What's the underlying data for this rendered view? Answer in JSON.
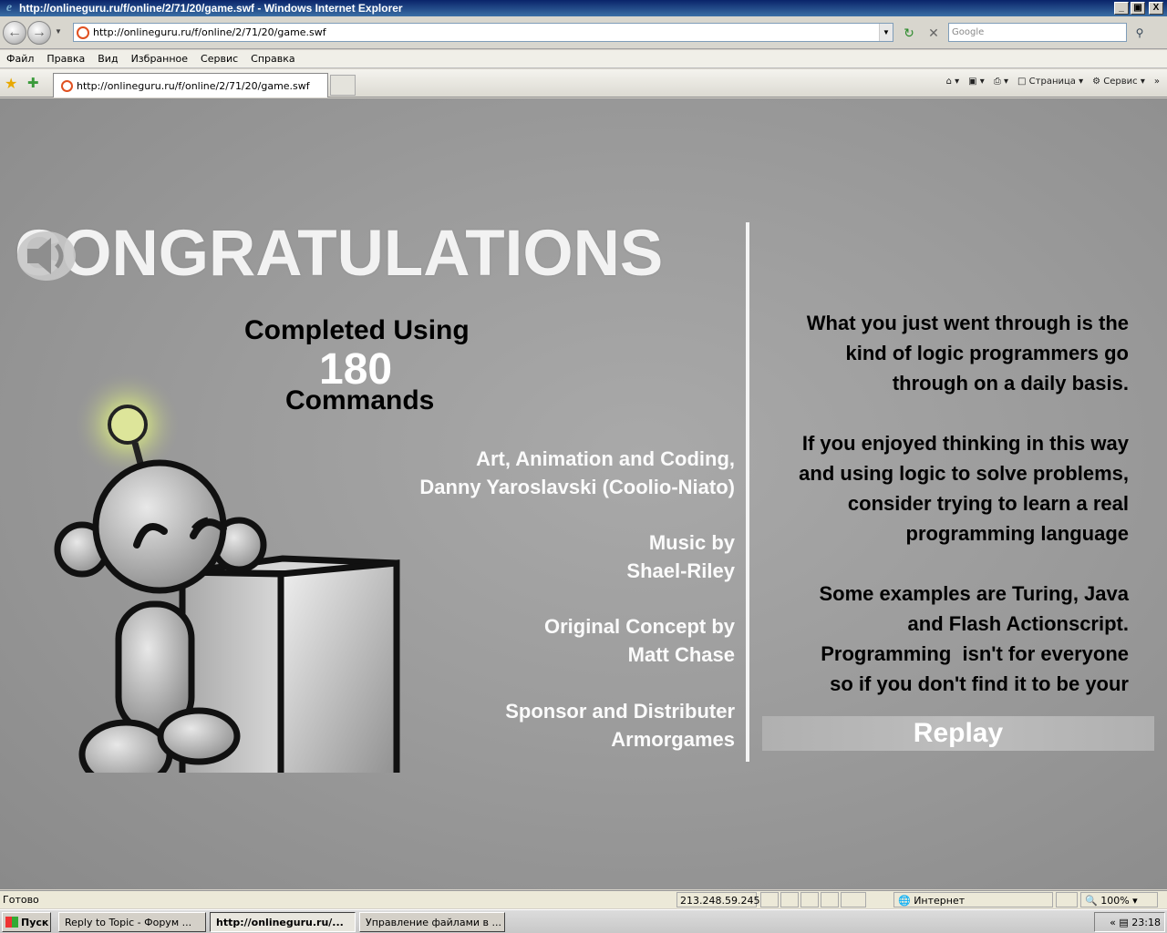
{
  "window": {
    "title": "http://onlineguru.ru/f/online/2/71/20/game.swf - Windows Internet Explorer",
    "minimize": "_",
    "maximize": "▣",
    "close": "X"
  },
  "address_bar": {
    "url": "http://onlineguru.ru/f/online/2/71/20/game.swf",
    "search_placeholder": "Google"
  },
  "menu": [
    "Файл",
    "Правка",
    "Вид",
    "Избранное",
    "Сервис",
    "Справка"
  ],
  "tab": {
    "label": "http://onlineguru.ru/f/online/2/71/20/game.swf"
  },
  "toolbar": {
    "page": "Страница",
    "tools": "Сервис"
  },
  "game": {
    "heading": "CONGRATULATIONS",
    "completed_label": "Completed Using",
    "command_count": "180",
    "commands_label": "Commands",
    "credits": [
      {
        "line1": "Art, Animation and Coding,",
        "line2": "Danny Yaroslavski (Coolio-Niato)"
      },
      {
        "line1": "Music by",
        "line2": "Shael-Riley"
      },
      {
        "line1": "Original Concept by",
        "line2": "Matt Chase"
      },
      {
        "line1": "Sponsor and Distributer",
        "line2": "Armorgames"
      }
    ],
    "messages": [
      {
        "l1": "What you just went through is the",
        "l2": "kind of logic programmers go",
        "l3": "through on a daily basis.",
        "l4": ""
      },
      {
        "l1": "If you enjoyed thinking in this way",
        "l2": "and using logic to solve problems,",
        "l3": "consider trying to learn a real",
        "l4": "programming language"
      },
      {
        "l1": "Some examples are Turing, Java",
        "l2": "and Flash Actionscript.",
        "l3": "Programming  isn't for everyone",
        "l4": "so if you don't find it to be your"
      }
    ],
    "replay_label": "Replay"
  },
  "status_bar": {
    "status": "Готово",
    "ip": "213.248.59.245",
    "zone": "Интернет",
    "zoom": "100%"
  },
  "taskbar": {
    "start": "Пуск",
    "tasks": [
      "Reply to Topic - Форум ...",
      "http://onlineguru.ru/...",
      "Управление файлами в ..."
    ],
    "clock": "23:18"
  }
}
